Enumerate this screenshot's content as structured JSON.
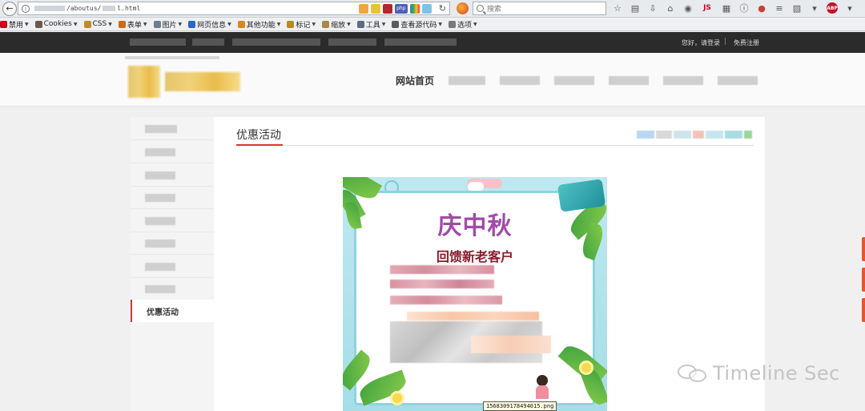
{
  "browser": {
    "url_path_1": "/aboutus/",
    "url_path_2": "l.html",
    "search_placeholder": "搜索",
    "toolbar_js_label": "JS",
    "abp_label": "ABP"
  },
  "bookmarks": [
    {
      "label": "禁用",
      "icon": "no-entry-icon",
      "color": "#d0021b"
    },
    {
      "label": "Cookies",
      "icon": "user-icon",
      "color": "#6b5a48"
    },
    {
      "label": "CSS",
      "icon": "pencil-icon",
      "color": "#c08a2b"
    },
    {
      "label": "表单",
      "icon": "form-icon",
      "color": "#cc6a18"
    },
    {
      "label": "图片",
      "icon": "image-icon",
      "color": "#6c7f8f"
    },
    {
      "label": "网页信息",
      "icon": "info-icon",
      "color": "#2a66c8"
    },
    {
      "label": "其他功能",
      "icon": "folder-icon",
      "color": "#d68a1d"
    },
    {
      "label": "标记",
      "icon": "marker-icon",
      "color": "#b88a22"
    },
    {
      "label": "缩放",
      "icon": "ruler-icon",
      "color": "#a58a45"
    },
    {
      "label": "工具",
      "icon": "tools-icon",
      "color": "#5b6d80"
    },
    {
      "label": "查看源代码",
      "icon": "source-icon",
      "color": "#5a5a5a"
    },
    {
      "label": "选项",
      "icon": "options-icon",
      "color": "#7a7a7a"
    }
  ],
  "site": {
    "top_login": "您好，请登录",
    "top_register": "免费注册",
    "top_sep": "|",
    "nav_home": "网站首页",
    "sidebar_active": "优惠活动",
    "section_title": "优惠活动"
  },
  "poster": {
    "headline": "庆中秋",
    "subheadline": "回馈新老客户"
  },
  "tooltip_filename": "1568309178494015.png",
  "watermark": "Timeline Sec",
  "colors": {
    "accent_red": "#d9352c",
    "topbar_dark": "#2b2b2b",
    "poster_purple": "#a24aa8",
    "poster_maroon": "#8a1a2a"
  }
}
